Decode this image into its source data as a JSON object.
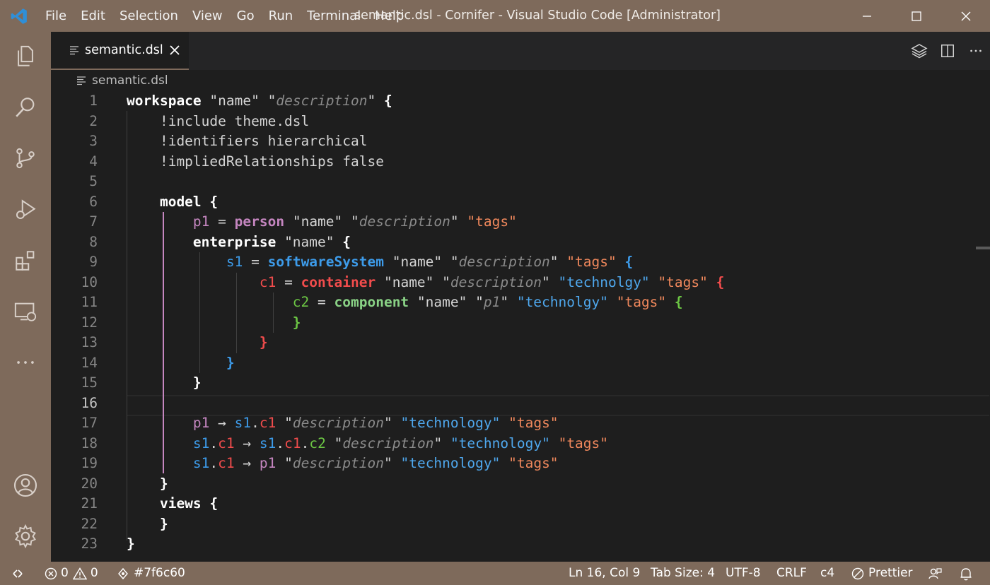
{
  "window": {
    "title": "semantic.dsl - Cornifer - Visual Studio Code [Administrator]",
    "menu": [
      "File",
      "Edit",
      "Selection",
      "View",
      "Go",
      "Run",
      "Terminal",
      "Help"
    ]
  },
  "tabs": [
    {
      "label": "semantic.dsl",
      "active": true
    }
  ],
  "breadcrumb": "semantic.dsl",
  "editor": {
    "line_numbers": [
      "1",
      "2",
      "3",
      "4",
      "5",
      "6",
      "7",
      "8",
      "9",
      "10",
      "11",
      "12",
      "13",
      "14",
      "15",
      "16",
      "17",
      "18",
      "19",
      "20",
      "21",
      "22",
      "23"
    ],
    "current_line": 16,
    "lines": [
      [
        [
          "kw",
          "workspace"
        ],
        [
          "str",
          " \"name\" \""
        ],
        [
          "desc",
          "description"
        ],
        [
          "str",
          "\" "
        ],
        [
          "brace-w",
          "{"
        ]
      ],
      [
        [
          "str",
          "    !include theme.dsl"
        ]
      ],
      [
        [
          "str",
          "    !identifiers hierarchical"
        ]
      ],
      [
        [
          "str",
          "    !impliedRelationships false"
        ]
      ],
      [],
      [
        [
          "kw",
          "    model "
        ],
        [
          "brace-w",
          "{"
        ]
      ],
      [
        [
          "person-id",
          "        p1"
        ],
        [
          "str",
          " = "
        ],
        [
          "person-kw",
          "person"
        ],
        [
          "str",
          " \"name\" \""
        ],
        [
          "desc",
          "description"
        ],
        [
          "str",
          "\" "
        ],
        [
          "tags",
          "\"tags\""
        ]
      ],
      [
        [
          "kw",
          "        enterprise"
        ],
        [
          "str",
          " \"name\" "
        ],
        [
          "brace-w",
          "{"
        ]
      ],
      [
        [
          "sys-id",
          "            s1"
        ],
        [
          "str",
          " = "
        ],
        [
          "sys-kw",
          "softwareSystem"
        ],
        [
          "str",
          " \"name\" \""
        ],
        [
          "desc",
          "description"
        ],
        [
          "str",
          "\" "
        ],
        [
          "tags",
          "\"tags\""
        ],
        [
          "str",
          " "
        ],
        [
          "brace-b",
          "{"
        ]
      ],
      [
        [
          "con-id",
          "                c1"
        ],
        [
          "str",
          " = "
        ],
        [
          "con-kw",
          "container"
        ],
        [
          "str",
          " \"name\" \""
        ],
        [
          "desc",
          "description"
        ],
        [
          "str",
          "\" "
        ],
        [
          "tech",
          "\"technolgy\""
        ],
        [
          "str",
          " "
        ],
        [
          "tags",
          "\"tags\""
        ],
        [
          "str",
          " "
        ],
        [
          "brace-r",
          "{"
        ]
      ],
      [
        [
          "comp-id",
          "                    c2"
        ],
        [
          "str",
          " = "
        ],
        [
          "comp-kw",
          "component"
        ],
        [
          "str",
          " \"name\" \""
        ],
        [
          "desc",
          "p1"
        ],
        [
          "str",
          "\" "
        ],
        [
          "tech",
          "\"technolgy\""
        ],
        [
          "str",
          " "
        ],
        [
          "tags",
          "\"tags\""
        ],
        [
          "str",
          " "
        ],
        [
          "brace-g",
          "{"
        ]
      ],
      [
        [
          "brace-g",
          "                    }"
        ]
      ],
      [
        [
          "brace-r",
          "                }"
        ]
      ],
      [
        [
          "brace-b",
          "            }"
        ]
      ],
      [
        [
          "brace-w",
          "        }"
        ]
      ],
      [],
      [
        [
          "person-id",
          "        p1"
        ],
        [
          "str",
          " → "
        ],
        [
          "sys-id",
          "s1"
        ],
        [
          "str",
          "."
        ],
        [
          "con-id",
          "c1"
        ],
        [
          "str",
          " \""
        ],
        [
          "desc",
          "description"
        ],
        [
          "str",
          "\" "
        ],
        [
          "tech",
          "\"technology\""
        ],
        [
          "str",
          " "
        ],
        [
          "tags",
          "\"tags\""
        ]
      ],
      [
        [
          "sys-id",
          "        s1"
        ],
        [
          "str",
          "."
        ],
        [
          "con-id",
          "c1"
        ],
        [
          "str",
          " → "
        ],
        [
          "sys-id",
          "s1"
        ],
        [
          "str",
          "."
        ],
        [
          "con-id",
          "c1"
        ],
        [
          "str",
          "."
        ],
        [
          "comp-id",
          "c2"
        ],
        [
          "str",
          " \""
        ],
        [
          "desc",
          "description"
        ],
        [
          "str",
          "\" "
        ],
        [
          "tech",
          "\"technology\""
        ],
        [
          "str",
          " "
        ],
        [
          "tags",
          "\"tags\""
        ]
      ],
      [
        [
          "sys-id",
          "        s1"
        ],
        [
          "str",
          "."
        ],
        [
          "con-id",
          "c1"
        ],
        [
          "str",
          " → "
        ],
        [
          "person-id",
          "p1"
        ],
        [
          "str",
          " \""
        ],
        [
          "desc",
          "description"
        ],
        [
          "str",
          "\" "
        ],
        [
          "tech",
          "\"technology\""
        ],
        [
          "str",
          " "
        ],
        [
          "tags",
          "\"tags\""
        ]
      ],
      [
        [
          "brace-w",
          "    }"
        ]
      ],
      [
        [
          "kw",
          "    views "
        ],
        [
          "brace-w",
          "{"
        ]
      ],
      [
        [
          "brace-w",
          "    }"
        ]
      ],
      [
        [
          "brace-w",
          "}"
        ]
      ]
    ]
  },
  "statusbar": {
    "errors": "0",
    "warnings": "0",
    "branch": "#7f6c60",
    "position": "Ln 16, Col 9",
    "tab_size": "Tab Size: 4",
    "encoding": "UTF-8",
    "eol": "CRLF",
    "language": "c4",
    "formatter": "Prettier"
  },
  "colors": {
    "accent": "#7e6a5b",
    "editor_bg": "#1e1e1e"
  },
  "icons": [
    "vscode-logo-icon",
    "minimize-icon",
    "maximize-icon",
    "close-icon",
    "explorer-icon",
    "search-icon",
    "source-control-icon",
    "run-debug-icon",
    "extensions-icon",
    "remote-explorer-icon",
    "more-icon",
    "account-icon",
    "settings-gear-icon",
    "file-icon",
    "layers-icon",
    "split-editor-icon",
    "remote-icon",
    "error-icon",
    "warning-icon",
    "git-commit-icon",
    "prettier-icon",
    "feedback-icon",
    "bell-icon"
  ]
}
